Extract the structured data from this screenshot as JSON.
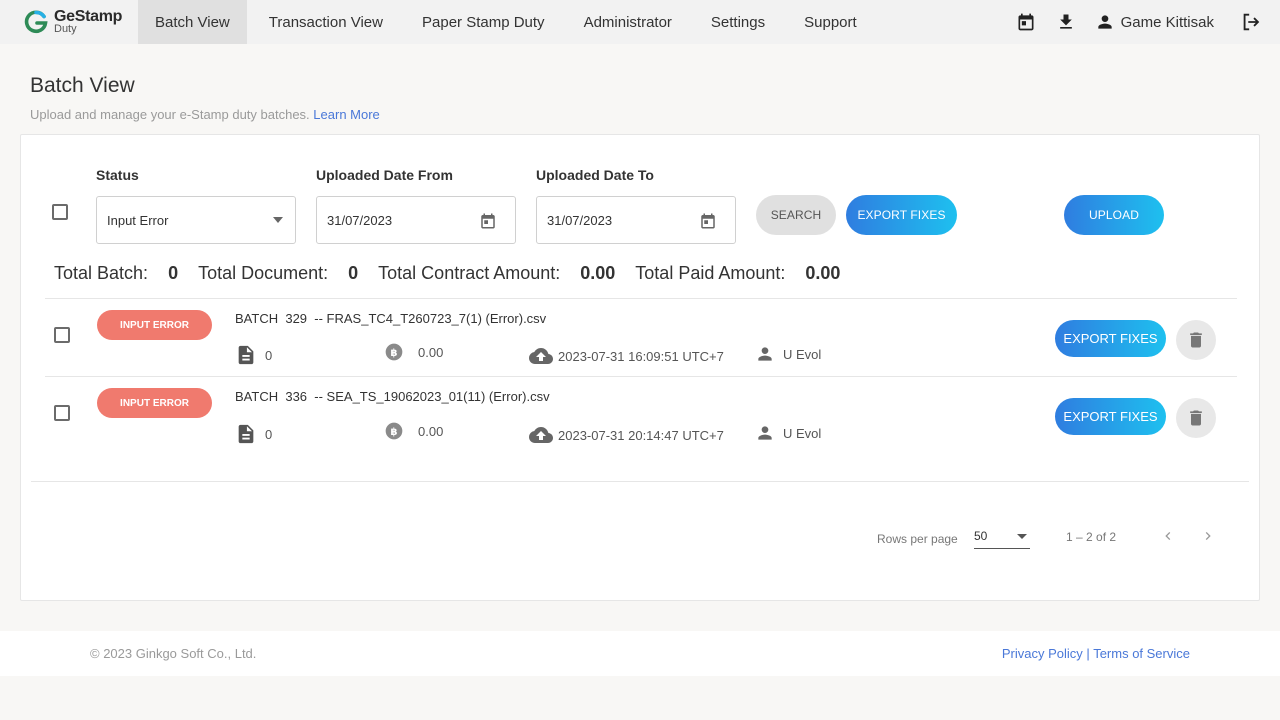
{
  "brand": {
    "title": "GeStamp",
    "subtitle": "Duty",
    "accent": "#2f7de0"
  },
  "nav": {
    "items": [
      {
        "label": "Batch View",
        "active": true
      },
      {
        "label": "Transaction View"
      },
      {
        "label": "Paper Stamp Duty"
      },
      {
        "label": "Administrator"
      },
      {
        "label": "Settings"
      },
      {
        "label": "Support"
      }
    ],
    "user_name": "Game Kittisak",
    "icons": [
      "calendar-icon",
      "download-icon",
      "user-icon",
      "logout-icon"
    ]
  },
  "page": {
    "title": "Batch View",
    "subtitle": "Upload and manage your e-Stamp duty batches.",
    "learn_more": "Learn More"
  },
  "filters": {
    "status_label": "Status",
    "status_value": "Input Error",
    "from_label": "Uploaded Date From",
    "from_value": "31/07/2023",
    "to_label": "Uploaded Date To",
    "to_value": "31/07/2023",
    "search_button": "SEARCH",
    "export_button": "EXPORT FIXES",
    "upload_button": "UPLOAD"
  },
  "totals": {
    "batch_label": "Total Batch:",
    "batch_value": "0",
    "document_label": "Total Document:",
    "document_value": "0",
    "contract_label": "Total Contract Amount:",
    "contract_value": "0.00",
    "paid_label": "Total Paid Amount:",
    "paid_value": "0.00"
  },
  "batches": [
    {
      "status": "INPUT ERROR",
      "prefix": "BATCH",
      "number": "329",
      "filename": "-- FRAS_TC4_T260723_7(1) (Error).csv",
      "documents": "0",
      "amount": "0.00",
      "uploaded": "2023-07-31 16:09:51 UTC+7",
      "user": "U Evol",
      "export_label": "EXPORT FIXES"
    },
    {
      "status": "INPUT ERROR",
      "prefix": "BATCH",
      "number": "336",
      "filename": "-- SEA_TS_19062023_01(11) (Error).csv",
      "documents": "0",
      "amount": "0.00",
      "uploaded": "2023-07-31 20:14:47 UTC+7",
      "user": "U Evol",
      "export_label": "EXPORT FIXES"
    }
  ],
  "pagination": {
    "rows_label": "Rows per page",
    "rows_value": "50",
    "range": "1 – 2 of 2"
  },
  "footer": {
    "copyright": "© 2023 Ginkgo Soft Co., Ltd.",
    "privacy": "Privacy Policy",
    "separator": "|",
    "terms": "Terms of Service"
  },
  "colors": {
    "error_badge": "#f07a6e",
    "link": "#4a78d8"
  }
}
